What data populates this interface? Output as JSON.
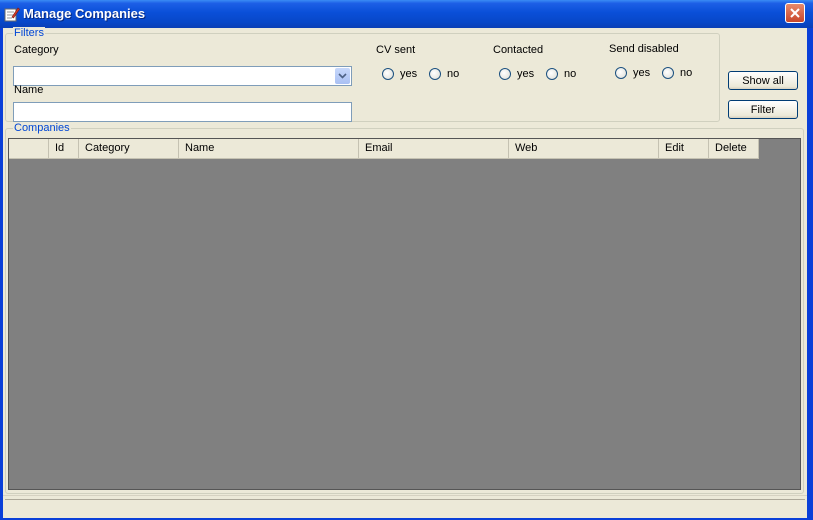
{
  "window": {
    "title": "Manage Companies"
  },
  "filters": {
    "legend": "Filters",
    "category_label": "Category",
    "category_value": "",
    "name_label": "Name",
    "name_value": "",
    "cv_sent": {
      "label": "CV sent",
      "yes": "yes",
      "no": "no",
      "selected": null
    },
    "contacted": {
      "label": "Contacted",
      "yes": "yes",
      "no": "no",
      "selected": null
    },
    "send_disabled": {
      "label": "Send disabled",
      "yes": "yes",
      "no": "no",
      "selected": null
    }
  },
  "buttons": {
    "show_all": "Show all",
    "filter": "Filter"
  },
  "companies": {
    "legend": "Companies",
    "columns": [
      "",
      "Id",
      "Category",
      "Name",
      "Email",
      "Web",
      "Edit",
      "Delete"
    ],
    "rows": []
  },
  "colors": {
    "title_bar": "#0a4fd8",
    "group_legend": "#0046d5",
    "grid_background": "#808080",
    "face": "#ece9d8"
  },
  "icons": {
    "app": "edit-pencil-icon",
    "close": "close-icon",
    "dropdown": "chevron-down-icon"
  }
}
